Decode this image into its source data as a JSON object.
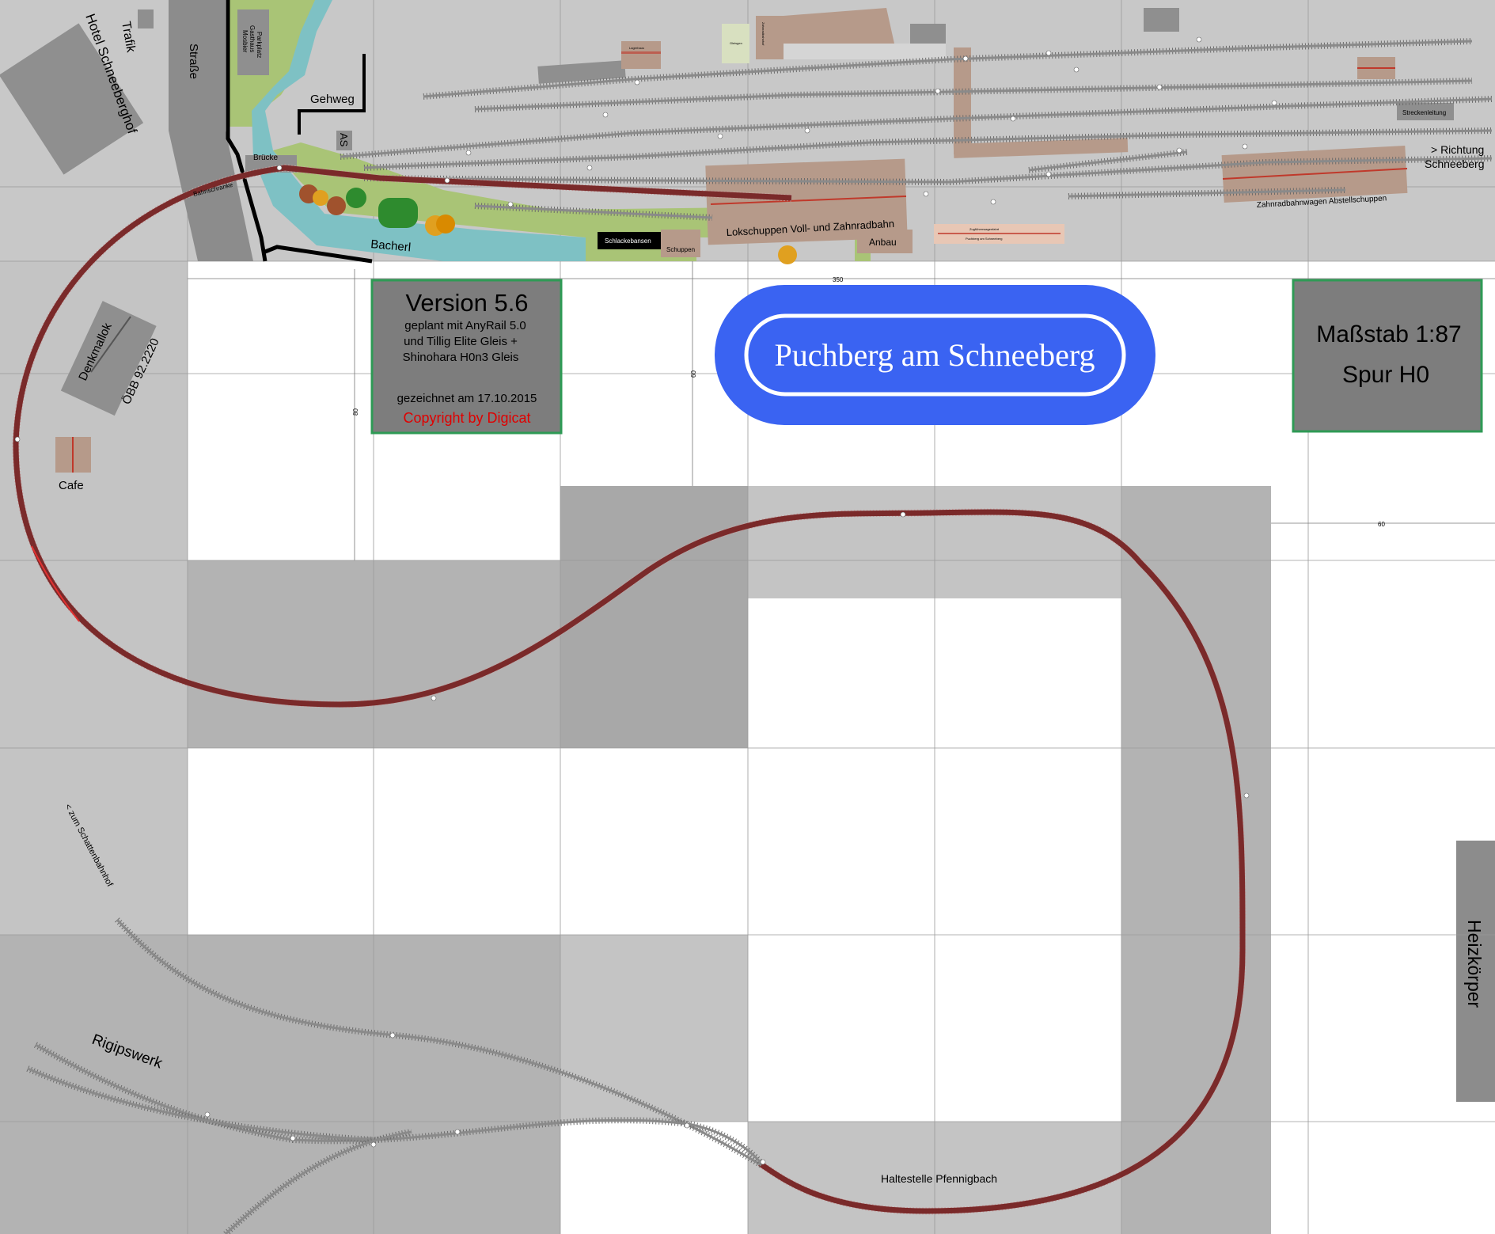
{
  "title": "Puchberg am Schneeberg",
  "version_box": {
    "version": "Version 5.6",
    "line1": "geplant mit AnyRail 5.0",
    "line2": "und Tillig Elite Gleis +",
    "line3": "Shinohara H0n3 Gleis",
    "drawn": "gezeichnet am 17.10.2015",
    "copyright": "Copyright by Digicat"
  },
  "scale_box": {
    "scale": "Maßstab 1:87",
    "gauge": "Spur H0"
  },
  "labels": {
    "trafik": "Trafik",
    "hotel": "Hotel Schneeberghof",
    "strasse": "Straße",
    "parkplatz_1": "Parkplatz",
    "parkplatz_2": "Gasthaus",
    "parkplatz_3": "Mosbier",
    "gehweg": "Gehweg",
    "as": "AS",
    "bruecke": "Brücke",
    "bahnschranke": "Bahnschranke",
    "bacherl": "Bacherl",
    "schlackebansen": "Schlackebansen",
    "schuppen": "Schuppen",
    "lokschuppen": "Lokschuppen Voll- und Zahnradbahn",
    "anbau": "Anbau",
    "zugfuehrerwagenfahrt_1": "Zugführerwagenfahrt",
    "zugfuehrerwagenfahrt_2": "Puchberg am Schneeberg",
    "lagerschuppen": "Lagerhaus",
    "gleisgen": "Gleisgen",
    "zahnradbahnhof": "Zahnradbahnhof",
    "streckenleitung": "Streckenleitung",
    "richtung_1": "> Richtung",
    "richtung_2": "Schneeberg",
    "abstellschuppen": "Zahnradbahnwagen Abstellschuppen",
    "denkmallok": "Denkmallok",
    "oebb": "ÖBB 92.2220",
    "cafe": "Cafe",
    "schattenbahnhof": "<  zum Schattenbahnhof",
    "rigipswerk": "Rigipswerk",
    "haltestelle": "Haltestelle Pfennigbach",
    "heizkoerper": "Heizkörper"
  },
  "dimensions": {
    "width": "350",
    "height_left": "80",
    "height_mid": "60",
    "right_gap": "60"
  },
  "colors": {
    "title_blue": "#3a63f2",
    "box_grey": "#7d7d7d",
    "box_border": "#2e9a55",
    "copyright_red": "#e00000",
    "water": "#7ec1c4",
    "grass": "#a9c476",
    "building": "#b69a8a",
    "track_red": "#7a2a2a"
  }
}
